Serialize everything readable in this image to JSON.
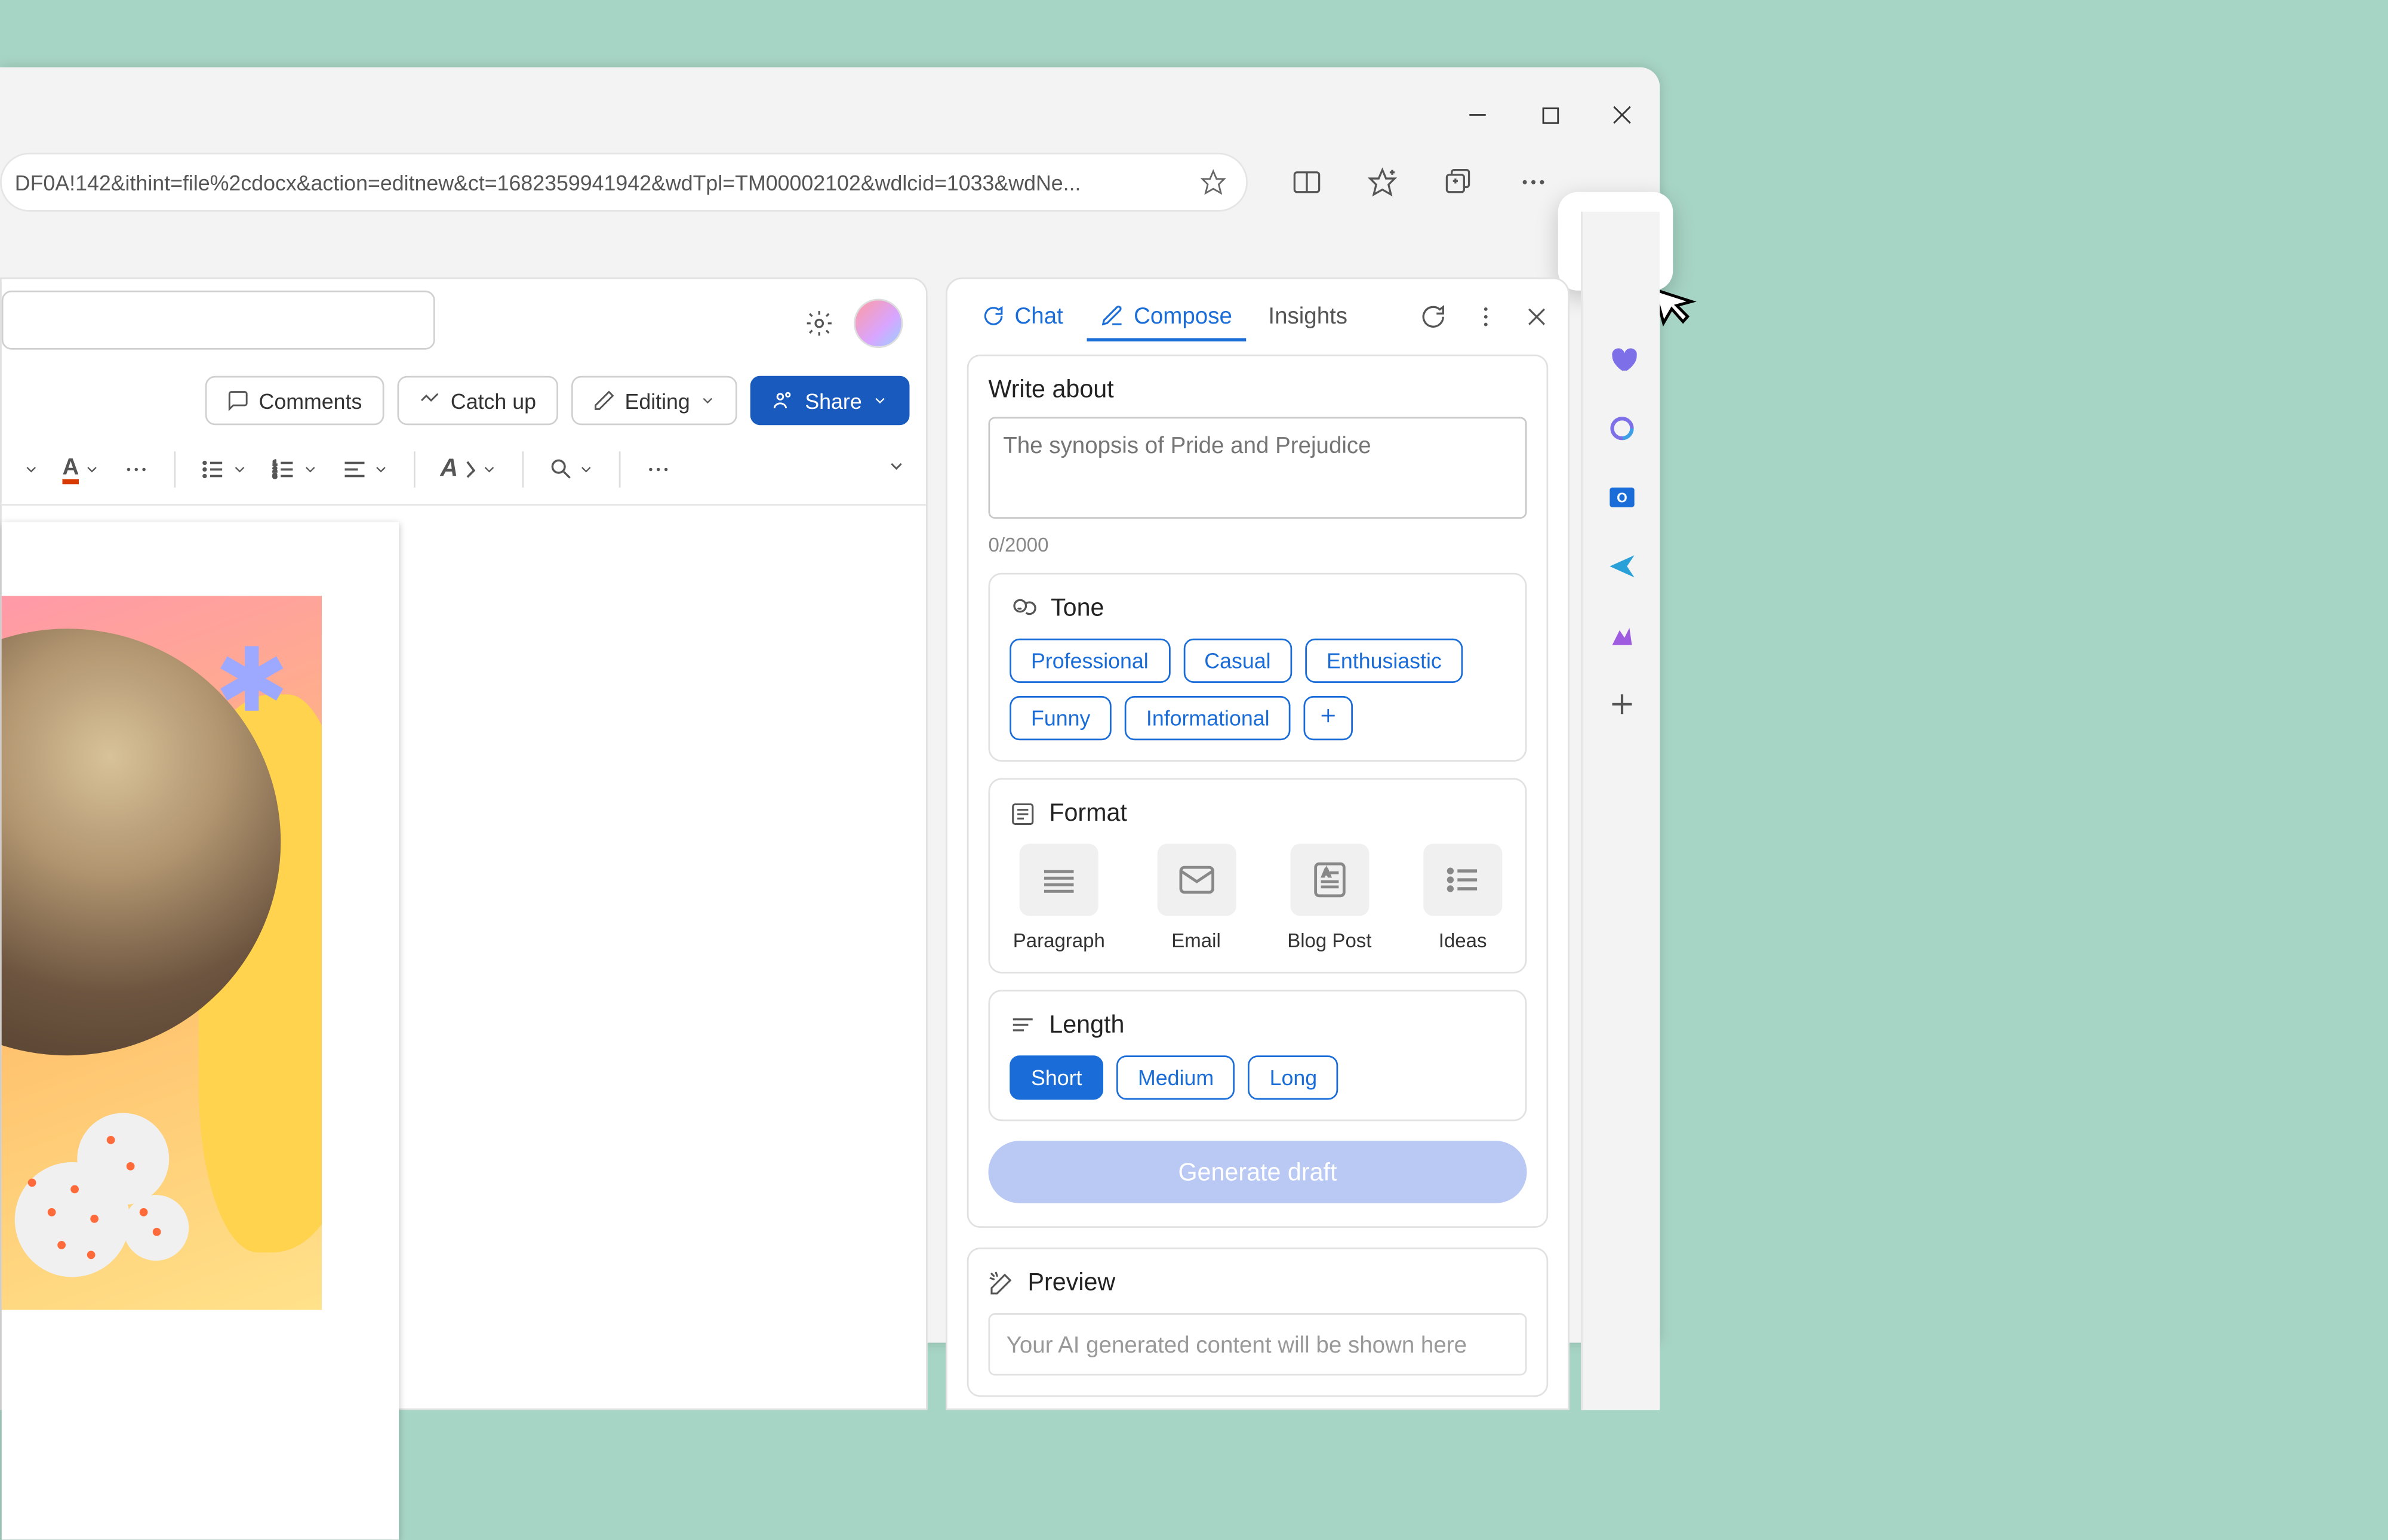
{
  "url_fragment": "DF0A!142&ithint=file%2cdocx&action=editnew&ct=1682359941942&wdTpl=TM00002102&wdlcid=1033&wdNe...",
  "window_controls": {
    "minimize": "minimize",
    "maximize": "maximize",
    "close": "close"
  },
  "doc": {
    "comments_label": "Comments",
    "catch_up_label": "Catch up",
    "editing_label": "Editing",
    "share_label": "Share"
  },
  "copilot": {
    "tabs": {
      "chat": "Chat",
      "compose": "Compose",
      "insights": "Insights"
    },
    "write_about_label": "Write about",
    "prompt_placeholder": "The synopsis of Pride and Prejudice",
    "char_counter": "0/2000",
    "tone": {
      "label": "Tone",
      "options": [
        "Professional",
        "Casual",
        "Enthusiastic",
        "Funny",
        "Informational"
      ]
    },
    "format": {
      "label": "Format",
      "options": [
        "Paragraph",
        "Email",
        "Blog Post",
        "Ideas"
      ]
    },
    "length": {
      "label": "Length",
      "options": [
        "Short",
        "Medium",
        "Long"
      ],
      "selected": "Short"
    },
    "generate_label": "Generate draft",
    "preview": {
      "label": "Preview",
      "placeholder": "Your AI generated content will be shown here"
    }
  }
}
